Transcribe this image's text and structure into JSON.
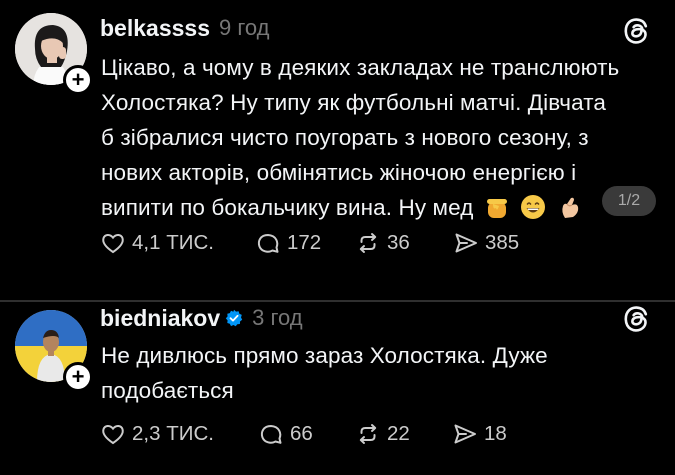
{
  "posts": [
    {
      "username": "belkassss",
      "time": "9 год",
      "lines": [
        "Цікаво, а чому в деяких закладах не транслюють",
        "Холостяка? Ну типу як футбольні матчі. Дівчата",
        "б зібралися чисто поугорать з нового сезону, з",
        "нових акторів, обмінятись жіночою енергією і",
        "випити по бокальчику вина. Ну мед"
      ],
      "emojis": [
        "honey-pot",
        "grinning-face",
        "pinching-hand"
      ],
      "page_indicator": "1/2",
      "likes": "4,1 ТИС.",
      "replies": "172",
      "reposts": "36",
      "shares": "385"
    },
    {
      "username": "biedniakov",
      "time": "3 год",
      "verified": true,
      "lines": [
        "Не дивлюсь прямо зараз Холостяка. Дуже",
        "подобається"
      ],
      "likes": "2,3 ТИС.",
      "replies": "66",
      "reposts": "22",
      "shares": "18"
    }
  ],
  "icons": {
    "follow": "plus-icon",
    "app": "threads-logo-icon",
    "like": "heart-icon",
    "reply": "comment-icon",
    "repost": "repost-icon",
    "share": "send-icon",
    "verified": "verified-badge-icon"
  },
  "colors": {
    "background": "#000000",
    "text": "#f3f5f7",
    "muted": "#777777",
    "verified": "#0095f6"
  }
}
